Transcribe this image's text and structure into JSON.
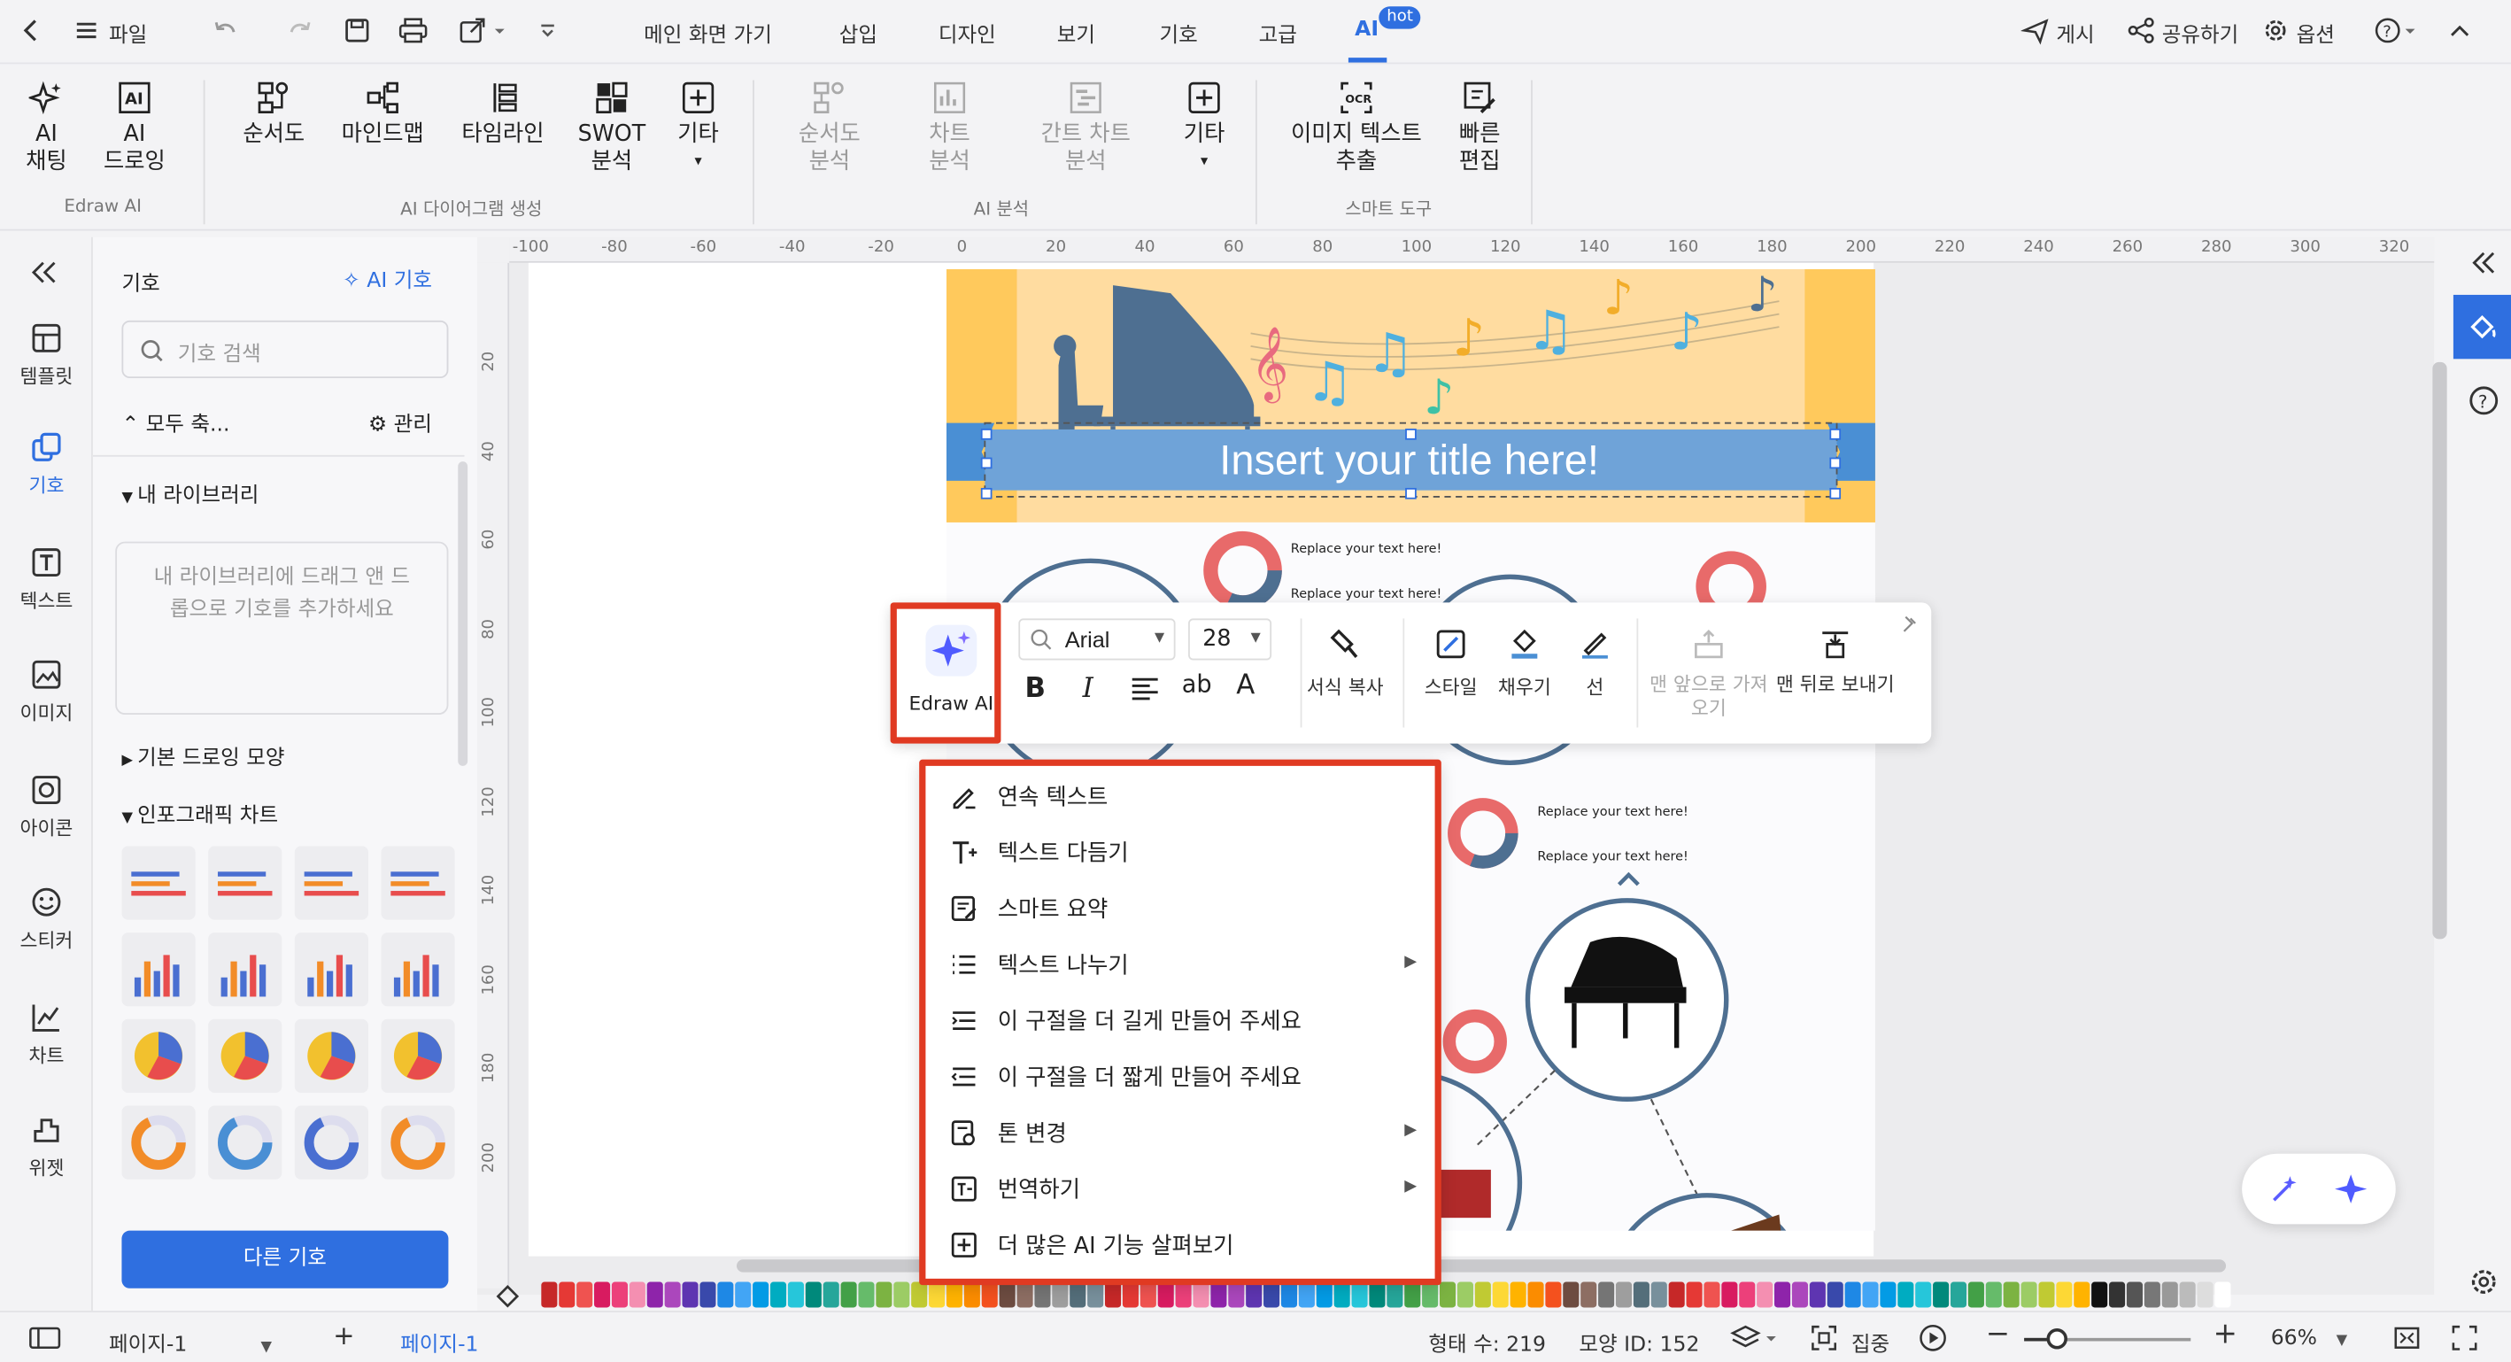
{
  "topbar": {
    "file": "파일",
    "menus": [
      "메인 화면 가기",
      "삽입",
      "디자인",
      "보기",
      "기호",
      "고급",
      "AI"
    ],
    "hot_badge": "hot",
    "publish": "게시",
    "share": "공유하기",
    "options": "옵션"
  },
  "ribbon": {
    "groups": [
      "Edraw AI",
      "AI 다이어그램 생성",
      "AI 분석",
      "스마트 도구"
    ],
    "buttons": [
      {
        "l1": "AI",
        "l2": "채팅"
      },
      {
        "l1": "AI",
        "l2": "드로잉"
      },
      {
        "l1": "순서도",
        "l2": ""
      },
      {
        "l1": "마인드맵",
        "l2": ""
      },
      {
        "l1": "타임라인",
        "l2": ""
      },
      {
        "l1": "SWOT",
        "l2": "분석"
      },
      {
        "l1": "기타",
        "l2": ""
      },
      {
        "l1": "순서도",
        "l2": "분석"
      },
      {
        "l1": "차트",
        "l2": "분석"
      },
      {
        "l1": "간트 차트",
        "l2": "분석"
      },
      {
        "l1": "기타",
        "l2": ""
      },
      {
        "l1": "이미지 텍스트",
        "l2": "추출"
      },
      {
        "l1": "빠른",
        "l2": "편집"
      }
    ]
  },
  "rail": {
    "items": [
      "템플릿",
      "기호",
      "텍스트",
      "이미지",
      "아이콘",
      "스티커",
      "차트",
      "위젯"
    ]
  },
  "library": {
    "title": "기호",
    "ai_symbol": "AI 기호",
    "search_placeholder": "기호 검색",
    "collapse_all": "모두 축...",
    "manage": "관리",
    "my_library": "내 라이브러리",
    "drop_hint": "내 라이브러리에 드래그 앤 드롭으로 기호를 추가하세요",
    "basic_shapes": "기본 드로잉 모양",
    "infographic": "인포그래픽 차트",
    "more_symbols": "다른 기호"
  },
  "ruler": {
    "top": [
      "-100",
      "-80",
      "-60",
      "-40",
      "-20",
      "0",
      "20",
      "40",
      "60",
      "80",
      "100",
      "120",
      "140",
      "160",
      "180",
      "200",
      "220",
      "240",
      "260",
      "280",
      "300",
      "320"
    ],
    "left": [
      "20",
      "40",
      "60",
      "80",
      "100",
      "120",
      "140",
      "160",
      "180",
      "200"
    ]
  },
  "canvas": {
    "title": "Insert your title here!",
    "replace": "Replace your text here!"
  },
  "floatbar": {
    "edraw_ai": "Edraw AI",
    "font": "Arial",
    "size": "28",
    "format_copy": "서식 복사",
    "style": "스타일",
    "fill": "채우기",
    "line": "선",
    "bring_front": "맨 앞으로 가져오기",
    "send_back": "맨 뒤로 보내기"
  },
  "context_menu": {
    "items": [
      {
        "label": "연속 텍스트",
        "sub": false
      },
      {
        "label": "텍스트 다듬기",
        "sub": false
      },
      {
        "label": "스마트 요약",
        "sub": false
      },
      {
        "label": "텍스트 나누기",
        "sub": true
      },
      {
        "label": "이 구절을 더 길게 만들어 주세요",
        "sub": false
      },
      {
        "label": "이 구절을 더 짧게 만들어 주세요",
        "sub": false
      },
      {
        "label": "톤 변경",
        "sub": true
      },
      {
        "label": "번역하기",
        "sub": true
      },
      {
        "label": "더 많은 AI 기능 살펴보기",
        "sub": false
      }
    ]
  },
  "status": {
    "page_selector": "페이지-1",
    "page_tab": "페이지-1",
    "shape_count": "형태 수: 219",
    "shape_id": "모양 ID: 152",
    "focus": "집중",
    "zoom": "66%"
  },
  "colors": {
    "accent": "#2f6fe0",
    "highlight": "#e03a22",
    "banner": "#ffdca0",
    "ribbon_blue": "#6fa3d8"
  }
}
